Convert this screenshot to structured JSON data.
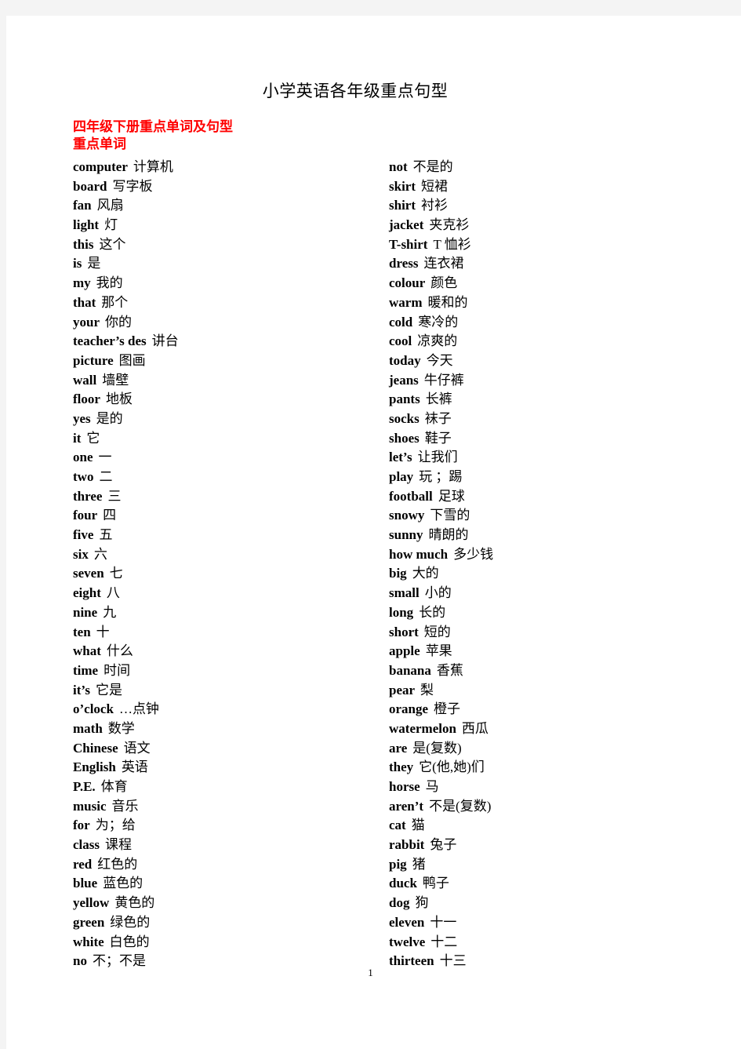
{
  "document": {
    "title": "小学英语各年级重点句型",
    "section_heading": "四年级下册重点单词及句型",
    "subsection_heading": "重点单词",
    "page_number": "1",
    "heading_color": "#ff0000",
    "body_color": "#000000"
  },
  "vocabulary": {
    "left_column": [
      {
        "term": "computer",
        "gloss": "计算机"
      },
      {
        "term": "board",
        "gloss": "写字板"
      },
      {
        "term": "fan",
        "gloss": "风扇"
      },
      {
        "term": "light",
        "gloss": "灯"
      },
      {
        "term": "this",
        "gloss": "这个"
      },
      {
        "term": "is",
        "gloss": "是"
      },
      {
        "term": "my",
        "gloss": "我的"
      },
      {
        "term": "that",
        "gloss": "那个"
      },
      {
        "term": "your",
        "gloss": "你的"
      },
      {
        "term": "teacher’s des",
        "gloss": "讲台"
      },
      {
        "term": "picture",
        "gloss": "图画"
      },
      {
        "term": "wall",
        "gloss": "墙壁"
      },
      {
        "term": "floor",
        "gloss": "地板"
      },
      {
        "term": "yes",
        "gloss": "是的"
      },
      {
        "term": "it",
        "gloss": "它"
      },
      {
        "term": "one",
        "gloss": "一"
      },
      {
        "term": "two",
        "gloss": "二"
      },
      {
        "term": "three",
        "gloss": "三"
      },
      {
        "term": "four",
        "gloss": "四"
      },
      {
        "term": "five",
        "gloss": "五"
      },
      {
        "term": "six",
        "gloss": "六"
      },
      {
        "term": "seven",
        "gloss": "七"
      },
      {
        "term": "eight",
        "gloss": "八"
      },
      {
        "term": "nine",
        "gloss": "九"
      },
      {
        "term": "ten",
        "gloss": "十"
      },
      {
        "term": "what",
        "gloss": "什么"
      },
      {
        "term": "time",
        "gloss": "时间"
      },
      {
        "term": "it’s",
        "gloss": "它是"
      },
      {
        "term": "o’clock",
        "gloss": "…点钟"
      },
      {
        "term": "math",
        "gloss": "数学"
      },
      {
        "term": "Chinese",
        "gloss": "语文"
      },
      {
        "term": "English",
        "gloss": "英语"
      },
      {
        "term": "P.E.",
        "gloss": "体育"
      },
      {
        "term": "music",
        "gloss": "音乐"
      },
      {
        "term": "for",
        "gloss": "为；给"
      },
      {
        "term": "class",
        "gloss": "课程"
      },
      {
        "term": "red",
        "gloss": "红色的"
      },
      {
        "term": "blue",
        "gloss": "蓝色的"
      },
      {
        "term": "yellow",
        "gloss": "黄色的"
      },
      {
        "term": "green",
        "gloss": "绿色的"
      },
      {
        "term": "white",
        "gloss": "白色的"
      },
      {
        "term": "no",
        "gloss": "不；不是"
      }
    ],
    "right_column": [
      {
        "term": "not",
        "gloss": "不是的"
      },
      {
        "term": "skirt",
        "gloss": "短裙"
      },
      {
        "term": "shirt",
        "gloss": "衬衫"
      },
      {
        "term": "jacket",
        "gloss": "夹克衫"
      },
      {
        "term": "T-shirt",
        "gloss": "T 恤衫"
      },
      {
        "term": "dress",
        "gloss": "连衣裙"
      },
      {
        "term": "colour",
        "gloss": "颜色"
      },
      {
        "term": "warm",
        "gloss": "暖和的"
      },
      {
        "term": "cold",
        "gloss": "寒冷的"
      },
      {
        "term": "cool",
        "gloss": "凉爽的"
      },
      {
        "term": "today",
        "gloss": "今天"
      },
      {
        "term": "jeans",
        "gloss": "牛仔裤"
      },
      {
        "term": "pants",
        "gloss": "长裤"
      },
      {
        "term": "socks",
        "gloss": "袜子"
      },
      {
        "term": "shoes",
        "gloss": "鞋子"
      },
      {
        "term": "let’s",
        "gloss": "让我们"
      },
      {
        "term": "play",
        "gloss": "玩 ；踢"
      },
      {
        "term": "football",
        "gloss": "足球"
      },
      {
        "term": "snowy",
        "gloss": "下雪的"
      },
      {
        "term": "sunny",
        "gloss": "晴朗的"
      },
      {
        "term": "how much",
        "gloss": "多少钱"
      },
      {
        "term": "big",
        "gloss": "大的"
      },
      {
        "term": "small",
        "gloss": "小的"
      },
      {
        "term": "long",
        "gloss": "长的"
      },
      {
        "term": "short",
        "gloss": "短的"
      },
      {
        "term": "apple",
        "gloss": "苹果"
      },
      {
        "term": "banana",
        "gloss": "香蕉"
      },
      {
        "term": "pear",
        "gloss": "梨"
      },
      {
        "term": "orange",
        "gloss": "橙子"
      },
      {
        "term": "watermelon",
        "gloss": "西瓜"
      },
      {
        "term": "are",
        "gloss": "是(复数)"
      },
      {
        "term": "they",
        "gloss": "它(他,她)们"
      },
      {
        "term": "horse",
        "gloss": "马"
      },
      {
        "term": "aren’t",
        "gloss": "不是(复数)"
      },
      {
        "term": "cat",
        "gloss": "猫"
      },
      {
        "term": "rabbit",
        "gloss": "兔子"
      },
      {
        "term": "pig",
        "gloss": "猪"
      },
      {
        "term": "duck",
        "gloss": "鸭子"
      },
      {
        "term": "dog",
        "gloss": "狗"
      },
      {
        "term": "eleven",
        "gloss": "十一"
      },
      {
        "term": "twelve",
        "gloss": "十二"
      },
      {
        "term": "thirteen",
        "gloss": "十三"
      }
    ]
  }
}
